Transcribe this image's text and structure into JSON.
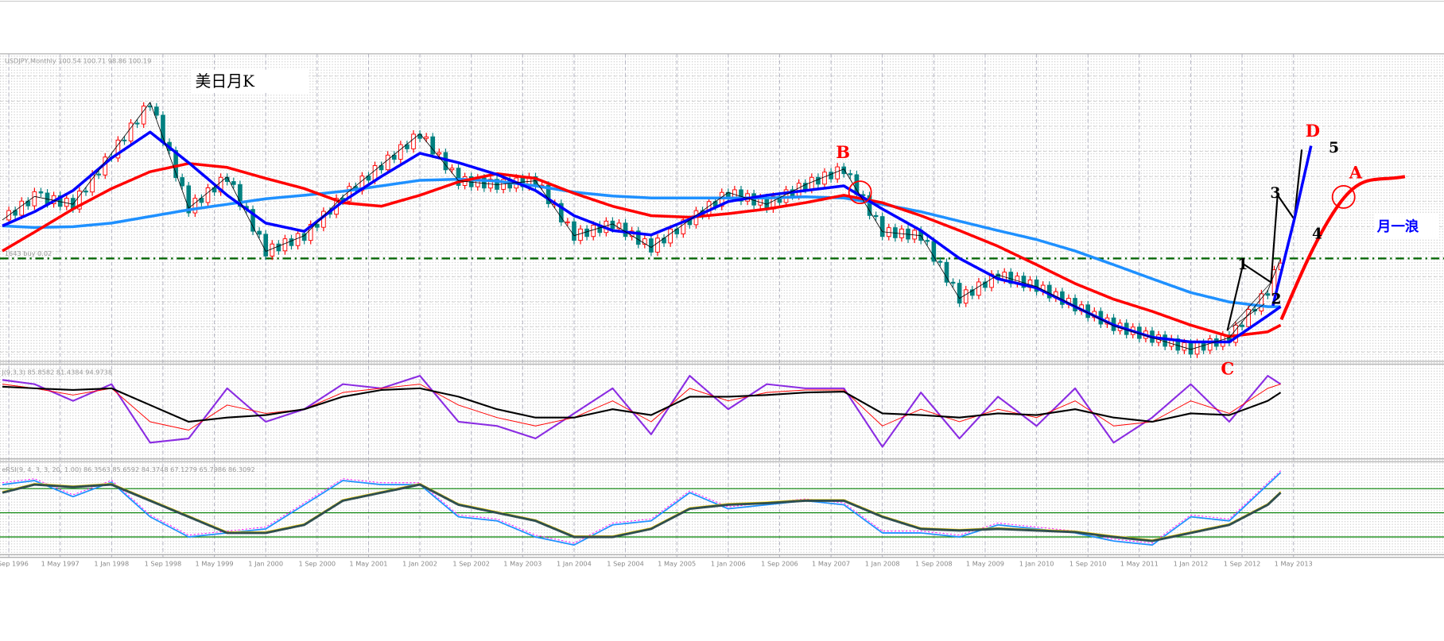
{
  "header": {
    "symbol_info": "USDJPY,Monthly  100.54 100.71 98.86 100.19",
    "chart_title": "美日月K",
    "line_label": "1643 buy 0.02"
  },
  "annotations": {
    "B": "B",
    "C": "C",
    "D": "D",
    "A": "A",
    "w1": "1",
    "w2": "2",
    "w3": "3",
    "w4": "4",
    "w5": "5",
    "wave_label": "月一浪"
  },
  "indicators": {
    "kdj_label": "J(9,3,3) 85.8582 81.4384 94.9738",
    "rsi_label": "eRSI(9, 4, 3, 3, 20, 1.00) 86.3563 85.6592 84.3748 67.1279 65.7986 86.3092"
  },
  "colors": {
    "bull_candle": "#ff0000",
    "bear_candle": "#008080",
    "ma_fast": "#0000ff",
    "ma_mid": "#ff0000",
    "ma_slow": "#1e90ff",
    "level_line": "#006400",
    "kdj_j": "#8a2be2",
    "kdj_k": "#ff0000",
    "kdj_d": "#000000",
    "rsi_fast": "#1e90ff",
    "rsi_slow": "#2f4f4f",
    "rsi_levels": "#008000"
  },
  "chart_data": [
    {
      "type": "line",
      "title": "USDJPY,Monthly",
      "x": [
        "1996-08",
        "1997-01",
        "1997-07",
        "1998-01",
        "1998-07",
        "1999-01",
        "1999-07",
        "2000-01",
        "2000-07",
        "2001-01",
        "2001-07",
        "2002-01",
        "2002-07",
        "2003-01",
        "2003-07",
        "2004-01",
        "2004-07",
        "2005-01",
        "2005-07",
        "2006-01",
        "2006-07",
        "2007-01",
        "2007-07",
        "2008-01",
        "2008-07",
        "2009-01",
        "2009-07",
        "2010-01",
        "2010-07",
        "2011-01",
        "2011-07",
        "2012-01",
        "2012-07",
        "2013-01",
        "2013-03"
      ],
      "ylim": [
        72,
        150
      ],
      "level_line": 100.19,
      "close": [
        110,
        116,
        114,
        127,
        140,
        113,
        121,
        102,
        106,
        116,
        124,
        132,
        120,
        119,
        120,
        106,
        109,
        103,
        110,
        117,
        114,
        119,
        123,
        107,
        106,
        90,
        96,
        93,
        88,
        83,
        80,
        77,
        80,
        92,
        100.2
      ],
      "series": [
        {
          "key": "ma_fast",
          "values": [
            108.5,
            112.1,
            117.5,
            125.8,
            132.4,
            124.6,
            116.3,
            109.2,
            107.1,
            114.7,
            121.1,
            127.0,
            124.6,
            121.6,
            117.5,
            111.1,
            107.3,
            106.2,
            110.2,
            114.7,
            116.3,
            117.5,
            118.7,
            112.8,
            107.3,
            100.2,
            95.0,
            92.7,
            87.9,
            83.2,
            80.1,
            78.9,
            78.9,
            85.6,
            87.9
          ]
        },
        {
          "key": "ma_mid",
          "values": [
            102.1,
            106.9,
            112.8,
            118.0,
            122.3,
            124.4,
            123.4,
            120.6,
            118.0,
            114.4,
            113.5,
            116.3,
            119.7,
            121.8,
            120.6,
            116.8,
            113.5,
            111.1,
            110.7,
            111.6,
            112.8,
            114.4,
            116.3,
            114.4,
            111.1,
            107.3,
            103.3,
            98.6,
            93.8,
            89.8,
            86.7,
            83.2,
            80.3,
            81.5,
            83.2
          ]
        },
        {
          "key": "ma_slow",
          "values": [
            108.5,
            108.1,
            108.3,
            109.2,
            110.9,
            112.6,
            114.0,
            115.4,
            116.3,
            117.3,
            118.7,
            120.1,
            120.4,
            119.9,
            118.7,
            117.1,
            116.1,
            115.6,
            115.6,
            115.6,
            115.6,
            115.9,
            115.6,
            114.0,
            112.1,
            109.7,
            107.3,
            105.0,
            102.1,
            98.6,
            95.0,
            91.5,
            89.1,
            87.9,
            87.9
          ]
        }
      ],
      "x_ticks": [
        {
          "date": "1996-09",
          "label": "Sep 1996"
        },
        {
          "date": "1997-05",
          "label": "1 May 1997"
        },
        {
          "date": "1998-01",
          "label": "1 Jan 1998"
        },
        {
          "date": "1998-09",
          "label": "1 Sep 1998"
        },
        {
          "date": "1999-05",
          "label": "1 May 1999"
        },
        {
          "date": "2000-01",
          "label": "1 Jan 2000"
        },
        {
          "date": "2000-09",
          "label": "1 Sep 2000"
        },
        {
          "date": "2001-05",
          "label": "1 May 2001"
        },
        {
          "date": "2002-01",
          "label": "1 Jan 2002"
        },
        {
          "date": "2002-09",
          "label": "1 Sep 2002"
        },
        {
          "date": "2003-05",
          "label": "1 May 2003"
        },
        {
          "date": "2004-01",
          "label": "1 Jan 2004"
        },
        {
          "date": "2004-09",
          "label": "1 Sep 2004"
        },
        {
          "date": "2005-05",
          "label": "1 May 2005"
        },
        {
          "date": "2006-01",
          "label": "1 Jan 2006"
        },
        {
          "date": "2006-09",
          "label": "1 Sep 2006"
        },
        {
          "date": "2007-05",
          "label": "1 May 2007"
        },
        {
          "date": "2008-01",
          "label": "1 Jan 2008"
        },
        {
          "date": "2008-09",
          "label": "1 Sep 2008"
        },
        {
          "date": "2009-05",
          "label": "1 May 2009"
        },
        {
          "date": "2010-01",
          "label": "1 Jan 2010"
        },
        {
          "date": "2010-09",
          "label": "1 Sep 2010"
        },
        {
          "date": "2011-05",
          "label": "1 May 2011"
        },
        {
          "date": "2012-01",
          "label": "1 Jan 2012"
        },
        {
          "date": "2012-09",
          "label": "1 Sep 2012"
        },
        {
          "date": "2013-05",
          "label": "1 May 2013"
        }
      ],
      "grid": true
    },
    {
      "type": "line",
      "title": "J(9,3,3)",
      "ylim": [
        0,
        100
      ],
      "series": [
        {
          "key": "kdj_j",
          "values": [
            90,
            85,
            65,
            85,
            15,
            20,
            80,
            40,
            55,
            85,
            80,
            95,
            40,
            35,
            20,
            50,
            80,
            25,
            95,
            55,
            85,
            80,
            80,
            10,
            75,
            20,
            70,
            35,
            80,
            15,
            45,
            85,
            40,
            95,
            85
          ]
        },
        {
          "key": "kdj_k",
          "values": [
            85,
            80,
            72,
            80,
            40,
            30,
            60,
            50,
            55,
            75,
            80,
            85,
            60,
            45,
            35,
            45,
            65,
            40,
            80,
            65,
            75,
            78,
            78,
            35,
            55,
            40,
            55,
            45,
            65,
            35,
            40,
            65,
            50,
            80,
            85
          ]
        },
        {
          "key": "kdj_d",
          "values": [
            82,
            80,
            78,
            80,
            60,
            40,
            45,
            48,
            55,
            70,
            78,
            80,
            70,
            55,
            45,
            45,
            55,
            48,
            70,
            70,
            72,
            75,
            76,
            50,
            48,
            45,
            50,
            48,
            55,
            45,
            40,
            50,
            48,
            65,
            75
          ]
        }
      ]
    },
    {
      "type": "line",
      "title": "eRSI(9, 4, 3, 3, 20, 1.00)",
      "levels": [
        80,
        50,
        20
      ],
      "series": [
        {
          "key": "rsi_fast",
          "values": [
            85,
            90,
            70,
            88,
            45,
            20,
            25,
            30,
            60,
            90,
            85,
            85,
            45,
            40,
            20,
            10,
            35,
            40,
            75,
            55,
            60,
            65,
            60,
            25,
            25,
            20,
            35,
            30,
            25,
            15,
            10,
            45,
            40,
            85,
            100
          ]
        },
        {
          "key": "rsi_slow",
          "values": [
            75,
            85,
            82,
            85,
            65,
            45,
            25,
            25,
            35,
            65,
            75,
            85,
            60,
            50,
            40,
            20,
            20,
            30,
            55,
            60,
            62,
            65,
            65,
            45,
            30,
            28,
            30,
            28,
            26,
            20,
            15,
            25,
            35,
            60,
            75
          ]
        }
      ]
    }
  ]
}
